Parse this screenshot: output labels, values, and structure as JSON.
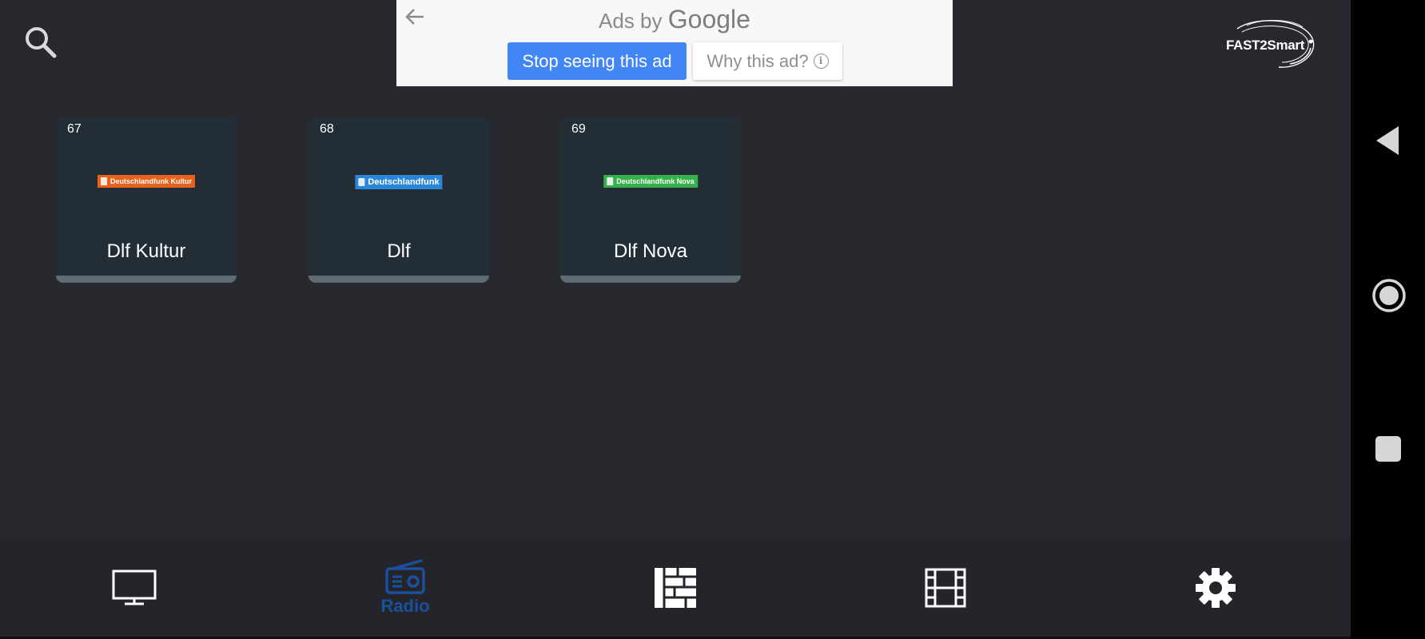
{
  "ad": {
    "title_prefix": "Ads by",
    "title_brand": "Google",
    "stop_label": "Stop seeing this ad",
    "why_label": "Why this ad?",
    "info_glyph": "i"
  },
  "brand": {
    "name": "FAST2Smart"
  },
  "channels": [
    {
      "number": "67",
      "name": "Dlf Kultur",
      "logo_text": "Deutschlandfunk Kultur",
      "logo_color": "#e8621d"
    },
    {
      "number": "68",
      "name": "Dlf",
      "logo_text": "Deutschlandfunk",
      "logo_color": "#2c86d8"
    },
    {
      "number": "69",
      "name": "Dlf Nova",
      "logo_text": "Deutschlandfunk Nova",
      "logo_color": "#36b04a"
    }
  ],
  "nav": {
    "items": [
      {
        "icon": "tv-icon",
        "label": ""
      },
      {
        "icon": "radio-icon",
        "label": "Radio",
        "active": true
      },
      {
        "icon": "guide-icon",
        "label": ""
      },
      {
        "icon": "film-icon",
        "label": ""
      },
      {
        "icon": "gear-icon",
        "label": ""
      }
    ]
  },
  "colors": {
    "background": "#28292e",
    "card": "#232d36",
    "active_nav": "#1c4f9c",
    "ad_button": "#4285f4"
  }
}
